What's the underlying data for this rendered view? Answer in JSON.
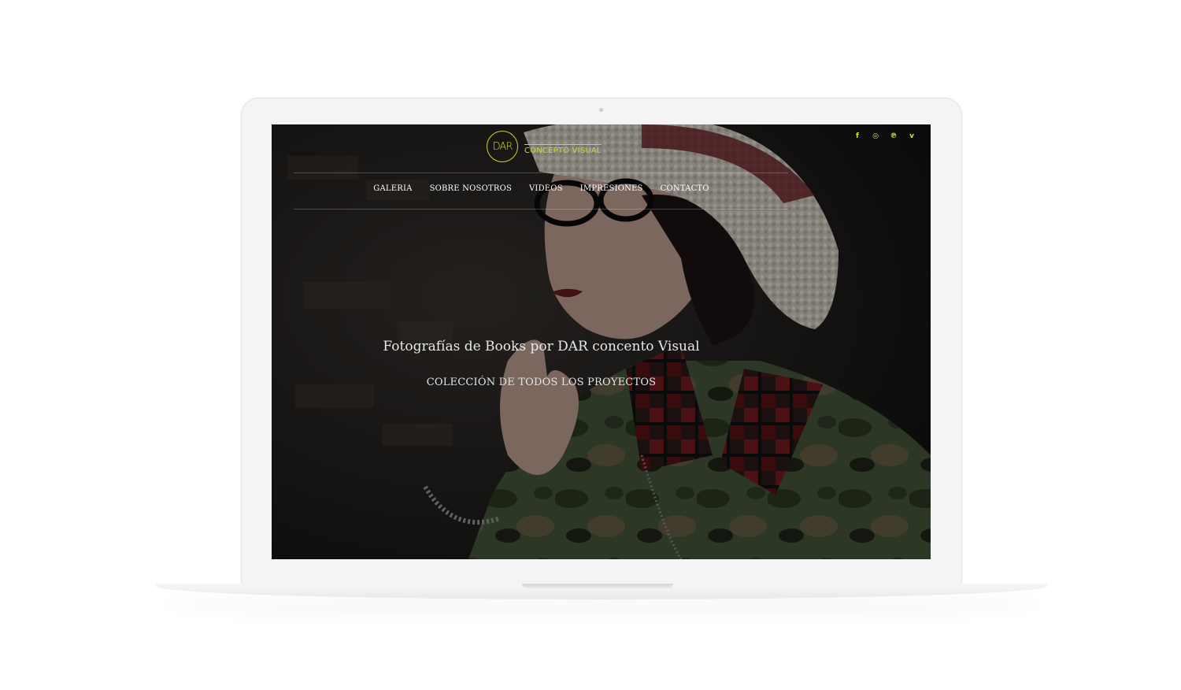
{
  "brand": {
    "logo_mark": "DAR",
    "logo_text": "CONCEPTO VISUAL",
    "accent_color": "#c9d62c"
  },
  "social": [
    {
      "icon": "facebook-icon",
      "glyph": "f"
    },
    {
      "icon": "instagram-icon",
      "glyph": "◎"
    },
    {
      "icon": "pinterest-icon",
      "glyph": "℗"
    },
    {
      "icon": "vimeo-icon",
      "glyph": "v"
    }
  ],
  "nav": {
    "items": [
      "GALERIA",
      "SOBRE NOSOTROS",
      "VIDEOS",
      "IMPRESIONES",
      "CONTACTO"
    ]
  },
  "hero": {
    "title": "Fotografías de Books por DAR concento Visual",
    "subtitle": "COLECCIÓN DE TODOS LOS PROYECTOS"
  }
}
